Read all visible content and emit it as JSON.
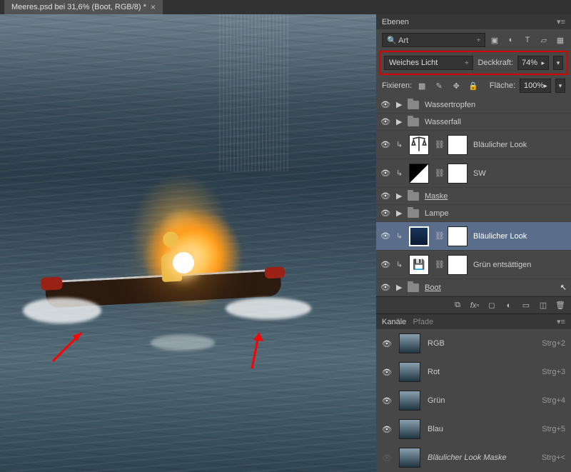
{
  "document": {
    "tab_title": "Meeres.psd bei 31,6% (Boot, RGB/8) *"
  },
  "layers_panel": {
    "title": "Ebenen",
    "search_label": "Art",
    "blend_mode": "Weiches Licht",
    "opacity_label": "Deckkraft:",
    "opacity_value": "74%",
    "lock_label": "Fixieren:",
    "fill_label": "Fläche:",
    "fill_value": "100%",
    "layers": [
      {
        "type": "group",
        "name": "Wassertropfen"
      },
      {
        "type": "group",
        "name": "Wasserfall"
      },
      {
        "type": "adj",
        "name": "Bläulicher Look",
        "clipped": true,
        "adj": "scale"
      },
      {
        "type": "adj",
        "name": "SW",
        "clipped": true,
        "adj": "gm"
      },
      {
        "type": "group",
        "name": "Maske",
        "underline": true
      },
      {
        "type": "group",
        "name": "Lampe"
      },
      {
        "type": "adj",
        "name": "Bläulicher Look",
        "clipped": true,
        "selected": true,
        "adj": "sel"
      },
      {
        "type": "adj",
        "name": "Grün entsättigen",
        "clipped": true,
        "adj": "disk"
      },
      {
        "type": "group",
        "name": "Boot",
        "underline": true,
        "cursor": true
      }
    ]
  },
  "channels_panel": {
    "tab1": "Kanäle",
    "tab2": "Pfade",
    "channels": [
      {
        "name": "RGB",
        "shortcut": "Strg+2"
      },
      {
        "name": "Rot",
        "shortcut": "Strg+3"
      },
      {
        "name": "Grün",
        "shortcut": "Strg+4"
      },
      {
        "name": "Blau",
        "shortcut": "Strg+5"
      },
      {
        "name": "Bläulicher Look Maske",
        "shortcut": "Strg+<",
        "hidden": true,
        "italic": true
      }
    ]
  }
}
